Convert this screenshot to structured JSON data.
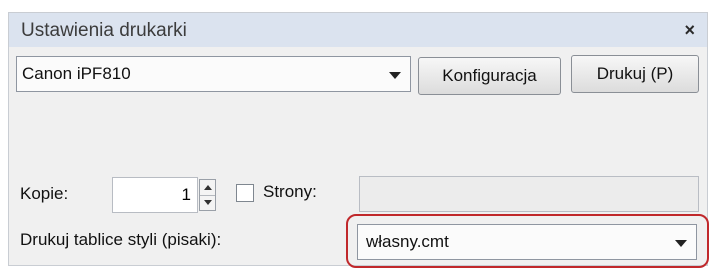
{
  "dialog": {
    "title": "Ustawienia drukarki",
    "close_glyph": "×"
  },
  "printer": {
    "selected": "Canon iPF810"
  },
  "buttons": {
    "config_label": "Konfiguracja",
    "print_label": "Drukuj  (P)"
  },
  "copies": {
    "label": "Kopie:",
    "value": "1"
  },
  "pages": {
    "label": "Strony:",
    "checked": false,
    "value": ""
  },
  "style_table": {
    "label": "Drukuj tablice styli (pisaki):",
    "selected": "własny.cmt"
  },
  "colors": {
    "highlight": "#c0282b",
    "titlebar": "#dbe3ef"
  }
}
